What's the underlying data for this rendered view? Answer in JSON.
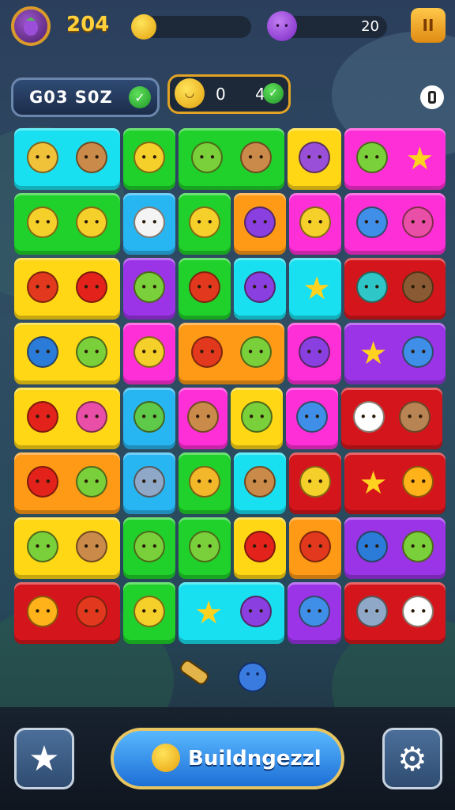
{
  "top": {
    "score": "204",
    "gem_count": "20",
    "pause_label": "II",
    "code": "G03 S0Z",
    "counter_a": "0",
    "counter_b": "4"
  },
  "bottom": {
    "main_button_label": "Buildngezzl"
  },
  "colors": {
    "cyan": "#18e0f0",
    "green": "#1fd12a",
    "yellow": "#ffd715",
    "magenta": "#ff2fd8",
    "orange": "#ff9a16",
    "purple": "#9a34e6",
    "blue": "#28b6f2",
    "red": "#d4161c"
  },
  "board": {
    "tiles": [
      {
        "color": "cyan",
        "items": [
          "pear",
          "cookie"
        ]
      },
      {
        "color": "green",
        "items": [
          "lemon"
        ]
      },
      {
        "color": "green",
        "items": [
          "lime",
          "cookie"
        ]
      },
      {
        "color": "yellow",
        "items": [
          "eggplant"
        ]
      },
      {
        "color": "magenta",
        "items": [
          "lime",
          "star"
        ]
      },
      {
        "color": "green",
        "items": [
          "lemon",
          "lemon"
        ]
      },
      {
        "color": "blue",
        "items": [
          "onion"
        ]
      },
      {
        "color": "green",
        "items": [
          "lemon"
        ]
      },
      {
        "color": "orange",
        "items": [
          "grape"
        ]
      },
      {
        "color": "magenta",
        "items": [
          "lemon"
        ]
      },
      {
        "color": "magenta",
        "items": [
          "blueberry",
          "pinkberry"
        ]
      },
      {
        "color": "yellow",
        "items": [
          "pepper",
          "apple"
        ]
      },
      {
        "color": "purple",
        "items": [
          "lime"
        ]
      },
      {
        "color": "green",
        "items": [
          "pepper"
        ]
      },
      {
        "color": "cyan",
        "items": [
          "grape"
        ]
      },
      {
        "color": "cyan",
        "items": [
          "star"
        ]
      },
      {
        "color": "red",
        "items": [
          "cucumber",
          "chocolate"
        ]
      },
      {
        "color": "yellow",
        "items": [
          "popsicle",
          "lime"
        ]
      },
      {
        "color": "magenta",
        "items": [
          "lemon"
        ]
      },
      {
        "color": "orange",
        "items": [
          "pepper",
          "lime"
        ]
      },
      {
        "color": "magenta",
        "items": [
          "grape"
        ]
      },
      {
        "color": "purple",
        "items": [
          "star",
          "blueberry"
        ]
      },
      {
        "color": "yellow",
        "items": [
          "apple",
          "pinkberry"
        ]
      },
      {
        "color": "blue",
        "items": [
          "melon"
        ]
      },
      {
        "color": "magenta",
        "items": [
          "cookie"
        ]
      },
      {
        "color": "yellow",
        "items": [
          "lime"
        ]
      },
      {
        "color": "magenta",
        "items": [
          "blueberry"
        ]
      },
      {
        "color": "red",
        "items": [
          "cream",
          "mushroom"
        ]
      },
      {
        "color": "orange",
        "items": [
          "apple",
          "lime"
        ]
      },
      {
        "color": "blue",
        "items": [
          "jar"
        ]
      },
      {
        "color": "green",
        "items": [
          "pineapple"
        ]
      },
      {
        "color": "cyan",
        "items": [
          "cookie"
        ]
      },
      {
        "color": "red",
        "items": [
          "lemon"
        ]
      },
      {
        "color": "red",
        "items": [
          "star",
          "sun"
        ]
      },
      {
        "color": "yellow",
        "items": [
          "lime",
          "cookie"
        ]
      },
      {
        "color": "green",
        "items": [
          "lime"
        ]
      },
      {
        "color": "green",
        "items": [
          "lime"
        ]
      },
      {
        "color": "yellow",
        "items": [
          "apple"
        ]
      },
      {
        "color": "orange",
        "items": [
          "pepper"
        ]
      },
      {
        "color": "purple",
        "items": [
          "popsicle",
          "lime"
        ]
      },
      {
        "color": "red",
        "items": [
          "sun",
          "pepper"
        ]
      },
      {
        "color": "green",
        "items": [
          "lemon"
        ]
      },
      {
        "color": "cyan",
        "items": [
          "star",
          "grape"
        ]
      },
      {
        "color": "purple",
        "items": [
          "blueberry"
        ]
      },
      {
        "color": "red",
        "items": [
          "jar",
          "cream"
        ]
      }
    ]
  }
}
